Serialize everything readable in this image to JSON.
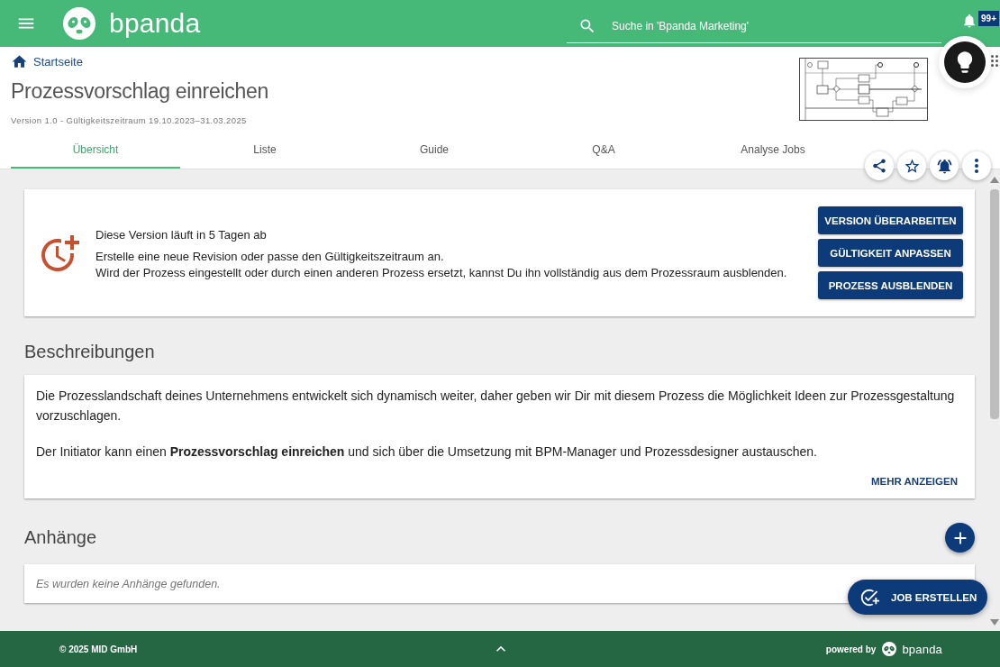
{
  "top_bar": {
    "logo_text": "bpanda",
    "search": {
      "placeholder": "Suche in 'Bpanda Marketing'"
    },
    "notification_badge": "99+"
  },
  "header": {
    "breadcrumb": "Startseite",
    "title": "Prozessvorschlag einreichen",
    "version_info": "Version 1.0 - Gültigkeitszeitraum 19.10.2023–31.03.2025",
    "tabs": [
      {
        "label": "Übersicht",
        "selected": true
      },
      {
        "label": "Liste",
        "selected": false
      },
      {
        "label": "Guide",
        "selected": false
      },
      {
        "label": "Q&A",
        "selected": false
      },
      {
        "label": "Analyse Jobs",
        "selected": false
      }
    ]
  },
  "expiry_notice": {
    "title": "Diese Version läuft in 5 Tagen ab",
    "lines": [
      "Erstelle eine neue Revision oder passe den Gültigkeitszeitraum an.",
      "Wird der Prozess eingestellt oder durch einen anderen Prozess ersetzt, kannst Du ihn vollständig aus dem Prozessraum ausblenden."
    ],
    "buttons": [
      "VERSION ÜBERARBEITEN",
      "GÜLTIGKEIT ANPASSEN",
      "PROZESS AUSBLENDEN"
    ]
  },
  "descriptions": {
    "heading": "Beschreibungen",
    "paragraphs": [
      "Die Prozesslandschaft deines Unternehmens entwickelt sich dynamisch weiter, daher geben wir Dir mit diesem Prozess die Möglichkeit Ideen zur Prozessgestaltung vorzuschlagen.",
      "Der Initiator kann einen **Prozessvorschlag einreichen** und sich über die Umsetzung mit BPM-Manager und Prozessdesigner austauschen."
    ],
    "more_link": "MEHR ANZEIGEN"
  },
  "attachments": {
    "heading": "Anhänge",
    "empty_message": "Es wurden keine Anhänge gefunden."
  },
  "job_button": "JOB ERSTELLEN",
  "footer": {
    "copyright": "© 2025 MID GmbH",
    "powered_by": "powered by",
    "logo_text": "bpanda"
  }
}
